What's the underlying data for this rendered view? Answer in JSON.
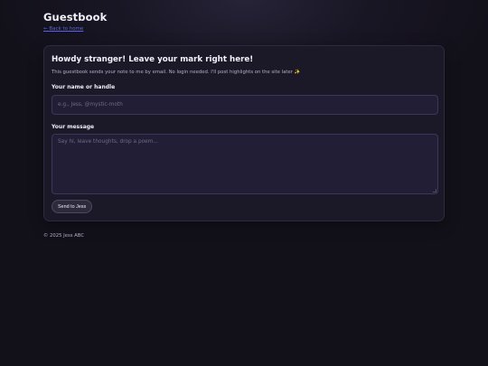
{
  "header": {
    "title": "Guestbook",
    "back_link": "← Back to home"
  },
  "form": {
    "heading": "Howdy stranger! Leave your mark right here!",
    "description": "This guestbook sends your note to me by email. No login needed. I'll post highlights on the site later ✨",
    "name_label": "Your name or handle",
    "name_placeholder": "e.g., Jess, @mystic-moth",
    "message_label": "Your message",
    "message_placeholder": "Say hi, leave thoughts, drop a poem...",
    "submit_label": "Send to Jess"
  },
  "footer": {
    "text": "© 2025 Jess ABC"
  },
  "colors": {
    "background": "#121019",
    "card": "#1b1828",
    "input": "#221e35",
    "link": "#5a63e6"
  }
}
